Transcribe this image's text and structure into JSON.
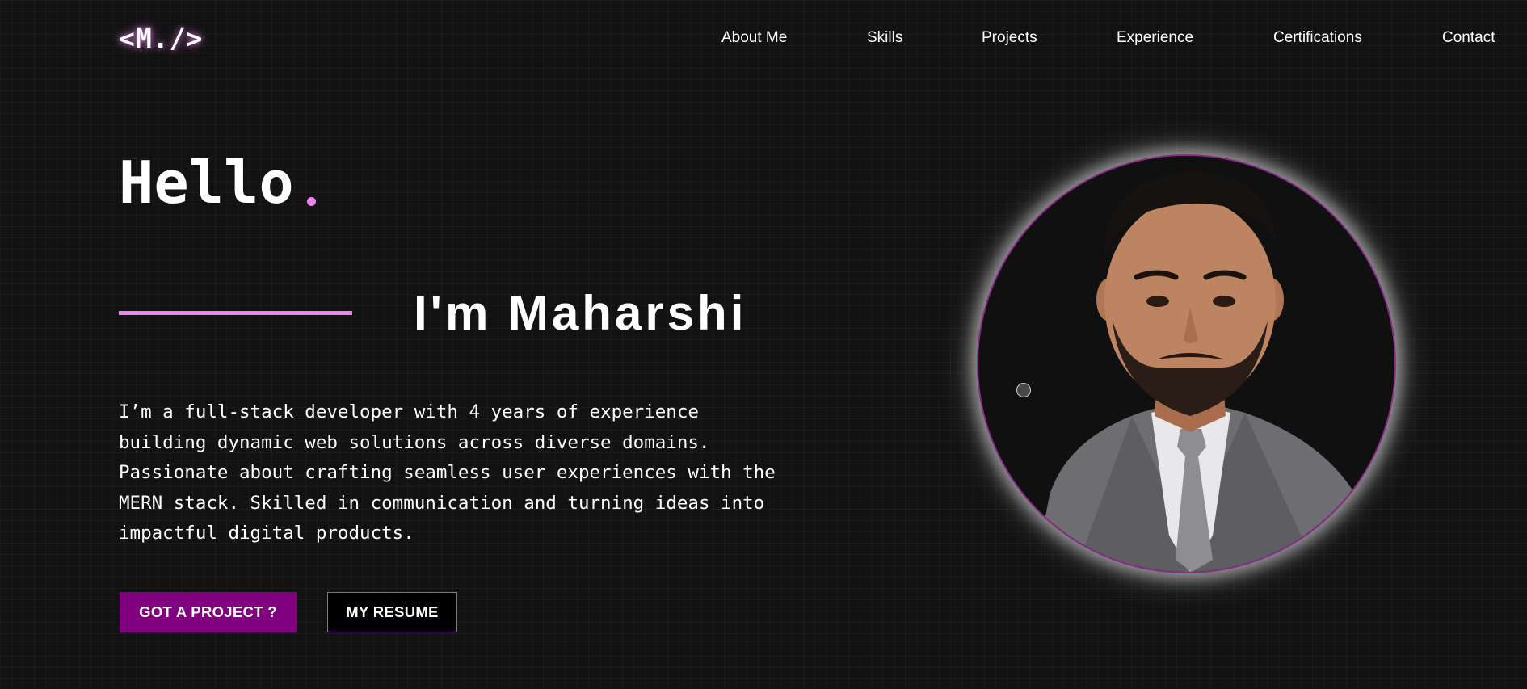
{
  "logo": {
    "text": "<M./>"
  },
  "nav": {
    "items": [
      {
        "label": "About Me"
      },
      {
        "label": "Skills"
      },
      {
        "label": "Projects"
      },
      {
        "label": "Experience"
      },
      {
        "label": "Certifications"
      },
      {
        "label": "Contact"
      }
    ]
  },
  "hero": {
    "greeting": "Hello",
    "intro": "I'm Maharshi",
    "bio": "I’m a full-stack developer with 4 years of experience building dynamic web solutions across diverse domains. Passionate about crafting seamless user experiences with the MERN stack. Skilled in communication and turning ideas into impactful digital products.",
    "buttons": {
      "primary": "GOT A PROJECT ?",
      "secondary": "MY RESUME"
    }
  },
  "colors": {
    "background": "#121212",
    "accent": "#ee82ee",
    "primary_button": "#800080",
    "secondary_button_border": "#9b59d0"
  },
  "icons": {
    "logo": "code-tag-logo",
    "cursor": "cursor-indicator-icon"
  }
}
